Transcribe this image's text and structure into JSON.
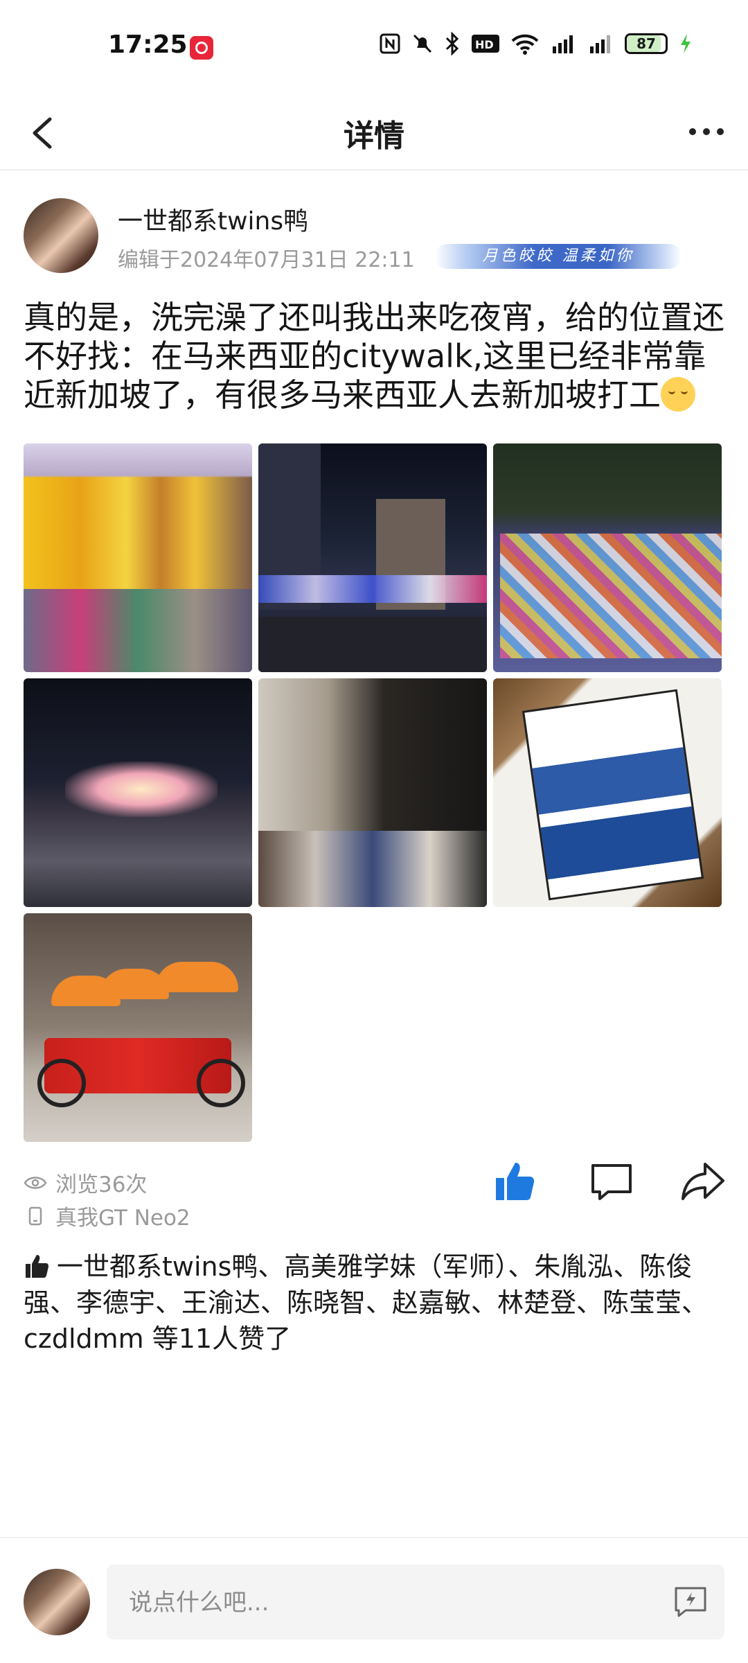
{
  "status_bar": {
    "time": "17:25",
    "battery": "87",
    "battery_level": 0.87
  },
  "nav": {
    "title": "详情",
    "back_icon": "chevron-left-icon",
    "more_icon": "more-dots-icon"
  },
  "post": {
    "author_name": "一世都系twins鸭",
    "edited": "编辑于2024年07月31日 22:11",
    "signature": "月色皎皎 温柔如你",
    "content": "真的是，洗完澡了还叫我出来吃夜宵，给的位置还不好找：在马来西亚的citywalk,这里已经非常靠近新加坡了，有很多马来西亚人去新加坡打工",
    "emoji": "relieved-face-emoji",
    "photos_count": 7,
    "views": "浏览36次",
    "device": "真我GT Neo2",
    "likes_text": "一世都系twins鸭、高美雅学妹（军师）、朱胤泓、陈俊强、李德宇、王渝达、陈晓智、赵嘉敏、林楚登、陈莹莹、czdldmm 等11人赞了"
  },
  "comment_bar": {
    "placeholder": "说点什么吧..."
  },
  "colors": {
    "accent_blue": "#1f7ae0",
    "text_gray": "#9a9a9a"
  }
}
